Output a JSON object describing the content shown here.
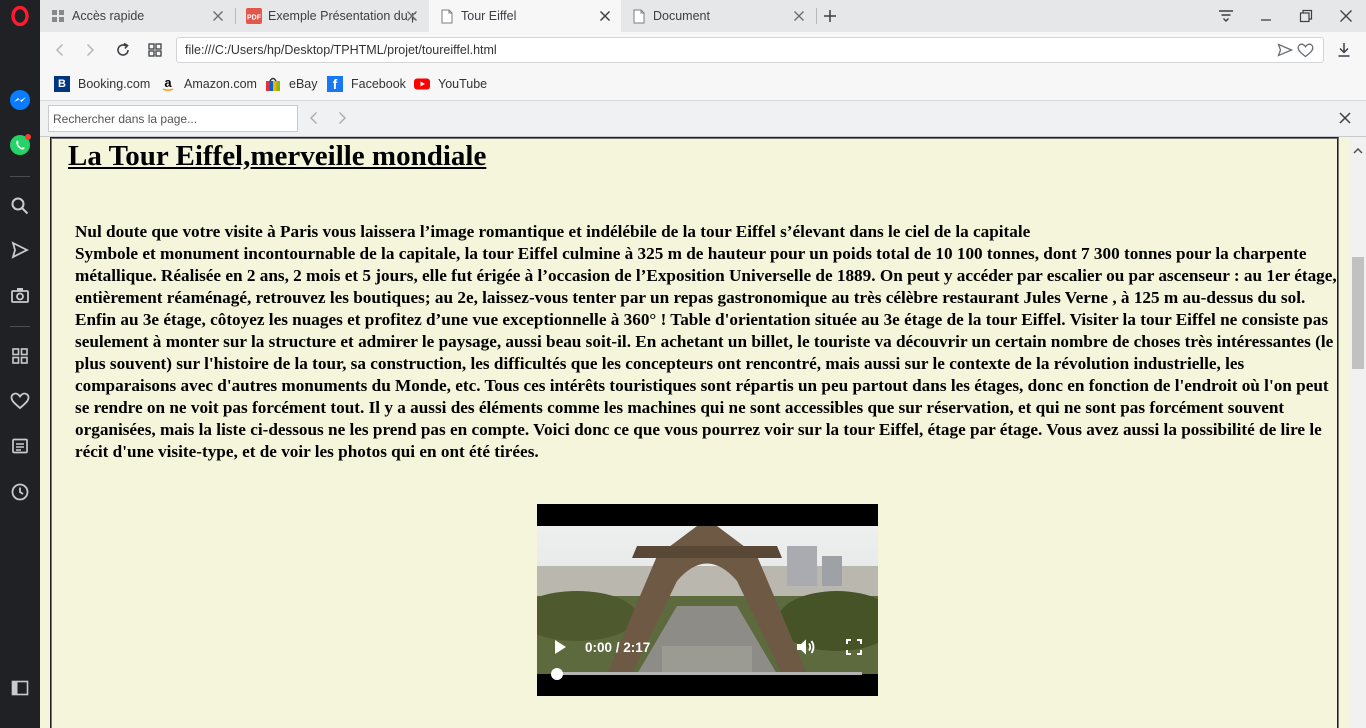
{
  "tabs": [
    {
      "label": "Accès rapide",
      "icon": "speed-dial-icon"
    },
    {
      "label": "Exemple Présentation du p",
      "icon": "pdf-icon"
    },
    {
      "label": "Tour Eiffel",
      "icon": "document-icon"
    },
    {
      "label": "Document",
      "icon": "document-icon"
    }
  ],
  "address": {
    "url": "file:///C:/Users/hp/Desktop/TPHTML/projet/toureiffel.html"
  },
  "bookmarks": [
    {
      "label": "Booking.com",
      "icon": "booking-icon",
      "color": "#003580"
    },
    {
      "label": "Amazon.com",
      "icon": "amazon-icon",
      "color": "#000000"
    },
    {
      "label": "eBay",
      "icon": "ebay-icon",
      "color": "#e53238"
    },
    {
      "label": "Facebook",
      "icon": "facebook-icon",
      "color": "#1877f2"
    },
    {
      "label": "YouTube",
      "icon": "youtube-icon",
      "color": "#ff0000"
    }
  ],
  "find": {
    "placeholder": "Rechercher dans la page..."
  },
  "page": {
    "title": "La Tour Eiffel,merveille mondiale",
    "intro": "Nul doute que votre visite à Paris vous laissera l’image romantique et indélébile de la tour Eiffel s’élevant dans le ciel de la capitale",
    "body": "Symbole et monument incontournable de la capitale, la tour Eiffel culmine à 325 m de hauteur pour un poids total de 10 100 tonnes, dont 7 300 tonnes pour la charpente métallique. Réalisée en 2 ans, 2 mois et 5 jours, elle fut érigée à l’occasion de l’Exposition Universelle de 1889. On peut y accéder par escalier ou par ascenseur : au 1er étage, entièrement réaménagé, retrouvez les boutiques; au 2e, laissez-vous tenter par un repas gastronomique au très célèbre restaurant Jules Verne , à 125 m au-dessus du sol. Enfin au 3e étage, côtoyez les nuages et profitez d’une vue exceptionnelle à 360° ! Table d'orientation située au 3e étage de la tour Eiffel. Visiter la tour Eiffel ne consiste pas seulement à monter sur la structure et admirer le paysage, aussi beau soit-il. En achetant un billet, le touriste va découvrir un certain nombre de choses très intéressantes (le plus souvent) sur l'histoire de la tour, sa construction, les difficultés que les concepteurs ont rencontré, mais aussi sur le contexte de la révolution industrielle, les comparaisons avec d'autres monuments du Monde, etc. Tous ces intérêts touristiques sont répartis un peu partout dans les étages, donc en fonction de l'endroit où l'on peut se rendre on ne voit pas forcément tout. Il y a aussi des éléments comme les machines qui ne sont accessibles que sur réservation, et qui ne sont pas forcément souvent organisées, mais la liste ci-dessous ne les prend pas en compte. Voici donc ce que vous pourrez voir sur la tour Eiffel, étage par étage. Vous avez aussi la possibilité de lire le récit d'une visite-type, et de voir les photos qui en ont été tirées."
  },
  "video": {
    "time": "0:00 / 2:17",
    "progress": 0
  },
  "colors": {
    "opera_red": "#ff1b2d",
    "page_bg": "#f5f5dc",
    "sidebar_bg": "#1f2124"
  }
}
